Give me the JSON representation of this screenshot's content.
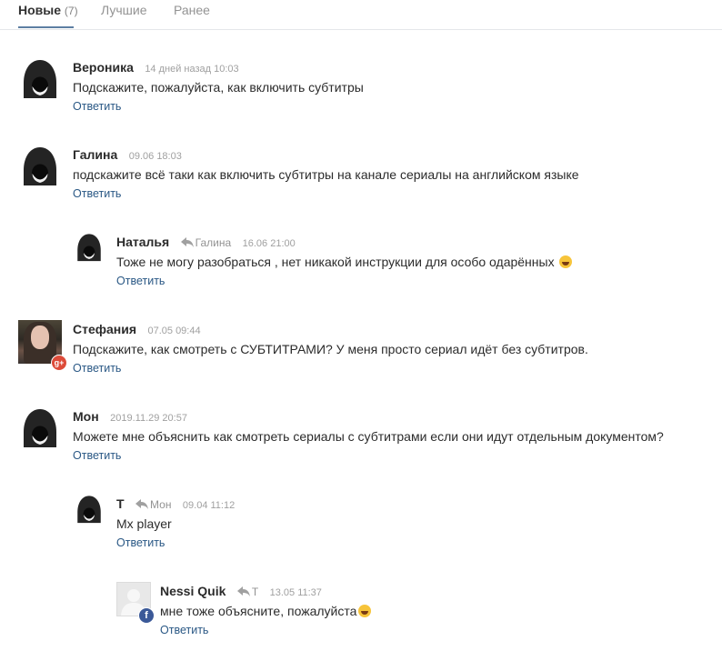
{
  "tabs": [
    {
      "label": "Новые",
      "count": "(7)"
    },
    {
      "label": "Лучшие"
    },
    {
      "label": "Ранее"
    }
  ],
  "comments": [
    {
      "author": "Вероника",
      "date": "14 дней назад 10:03",
      "text": "Подскажите, пожалуйста, как включить субтитры",
      "reply_label": "Ответить",
      "avatar": "hood-avatar"
    },
    {
      "author": "Галина",
      "date": "09.06 18:03",
      "text": "подскажите всё таки как включить субтитры на канале сериалы на английском языке",
      "reply_label": "Ответить",
      "avatar": "hood-avatar"
    },
    {
      "author": "Наталья",
      "reply_to": "Галина",
      "date": "16.06 21:00",
      "text": "Тоже не могу разобраться , нет никакой инструкции для особо одарённых",
      "emoji": "rolling-laughing-emoji",
      "reply_label": "Ответить",
      "avatar": "hood-avatar"
    },
    {
      "author": "Стефания",
      "date": "07.05 09:44",
      "text": "Подскажите, как смотреть с СУБТИТРАМИ? У меня просто сериал идёт без субтитров.",
      "reply_label": "Ответить",
      "avatar": "user-photo",
      "badge_text": "g+"
    },
    {
      "author": "Мон",
      "date": "2019.11.29 20:57",
      "text": "Можете мне объяснить как смотреть сериалы с субтитрами если они идут отдельным документом?",
      "reply_label": "Ответить",
      "avatar": "hood-avatar"
    },
    {
      "author": "T",
      "reply_to": "Мон",
      "date": "09.04 11:12",
      "text": "Mx player",
      "reply_label": "Ответить",
      "avatar": "hood-avatar"
    },
    {
      "author": "Nessi Quik",
      "reply_to": "T",
      "date": "13.05 11:37",
      "text": "мне тоже объясните, пожалуйста",
      "emoji": "sweat-smile-emoji",
      "reply_label": "Ответить",
      "avatar": "blank-avatar",
      "badge_text": "f"
    }
  ],
  "colors": {
    "link": "#2a5885",
    "muted": "#939393",
    "tab_underline": "#5d7fa3",
    "gplus": "#dd4b39",
    "facebook": "#3b5998"
  }
}
